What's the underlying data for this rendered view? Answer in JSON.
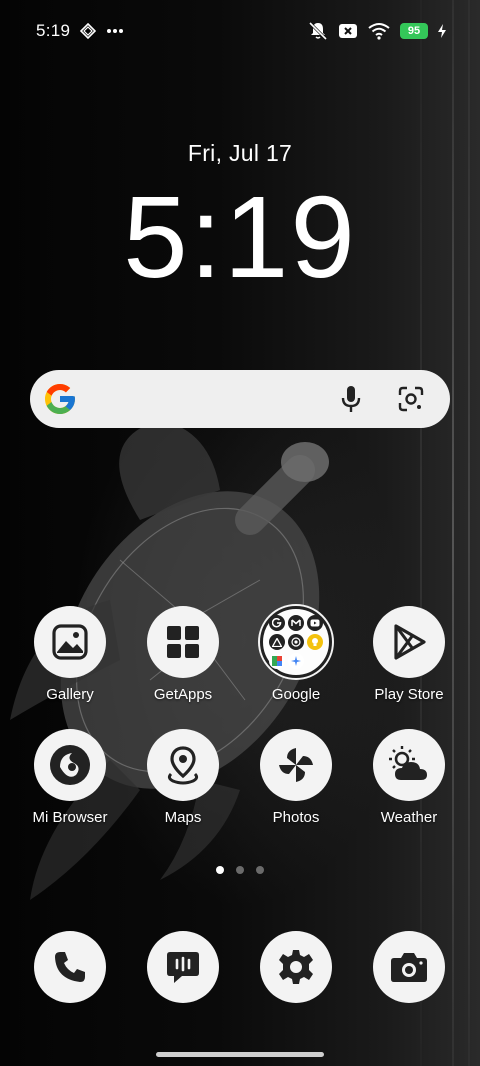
{
  "status_bar": {
    "time": "5:19",
    "battery_level": "95",
    "icons": [
      "diamond-icon",
      "more-dots-icon",
      "mute-icon",
      "sim-off-icon",
      "wifi-icon",
      "battery-icon",
      "charging-icon"
    ],
    "battery_color": "#34c759"
  },
  "clock": {
    "date": "Fri, Jul 17",
    "time": "5:19"
  },
  "search": {
    "icons": [
      "google-g-icon",
      "microphone-icon",
      "lens-icon"
    ]
  },
  "apps": [
    {
      "label": "Gallery",
      "icon": "gallery-icon"
    },
    {
      "label": "GetApps",
      "icon": "getapps-icon"
    },
    {
      "label": "Google",
      "icon": "folder-icon"
    },
    {
      "label": "Play Store",
      "icon": "play-store-icon"
    },
    {
      "label": "Mi Browser",
      "icon": "mi-browser-icon"
    },
    {
      "label": "Maps",
      "icon": "maps-icon"
    },
    {
      "label": "Photos",
      "icon": "photos-icon"
    },
    {
      "label": "Weather",
      "icon": "weather-icon"
    }
  ],
  "google_folder_contents": [
    "google-icon",
    "gmail-icon",
    "youtube-icon",
    "drive-icon",
    "chrome-icon",
    "keep-icon",
    "one-icon",
    "assistant-icon"
  ],
  "page_indicator": {
    "count": 3,
    "active": 1
  },
  "dock": [
    {
      "icon": "phone-icon"
    },
    {
      "icon": "messages-icon"
    },
    {
      "icon": "settings-icon"
    },
    {
      "icon": "camera-icon"
    }
  ]
}
